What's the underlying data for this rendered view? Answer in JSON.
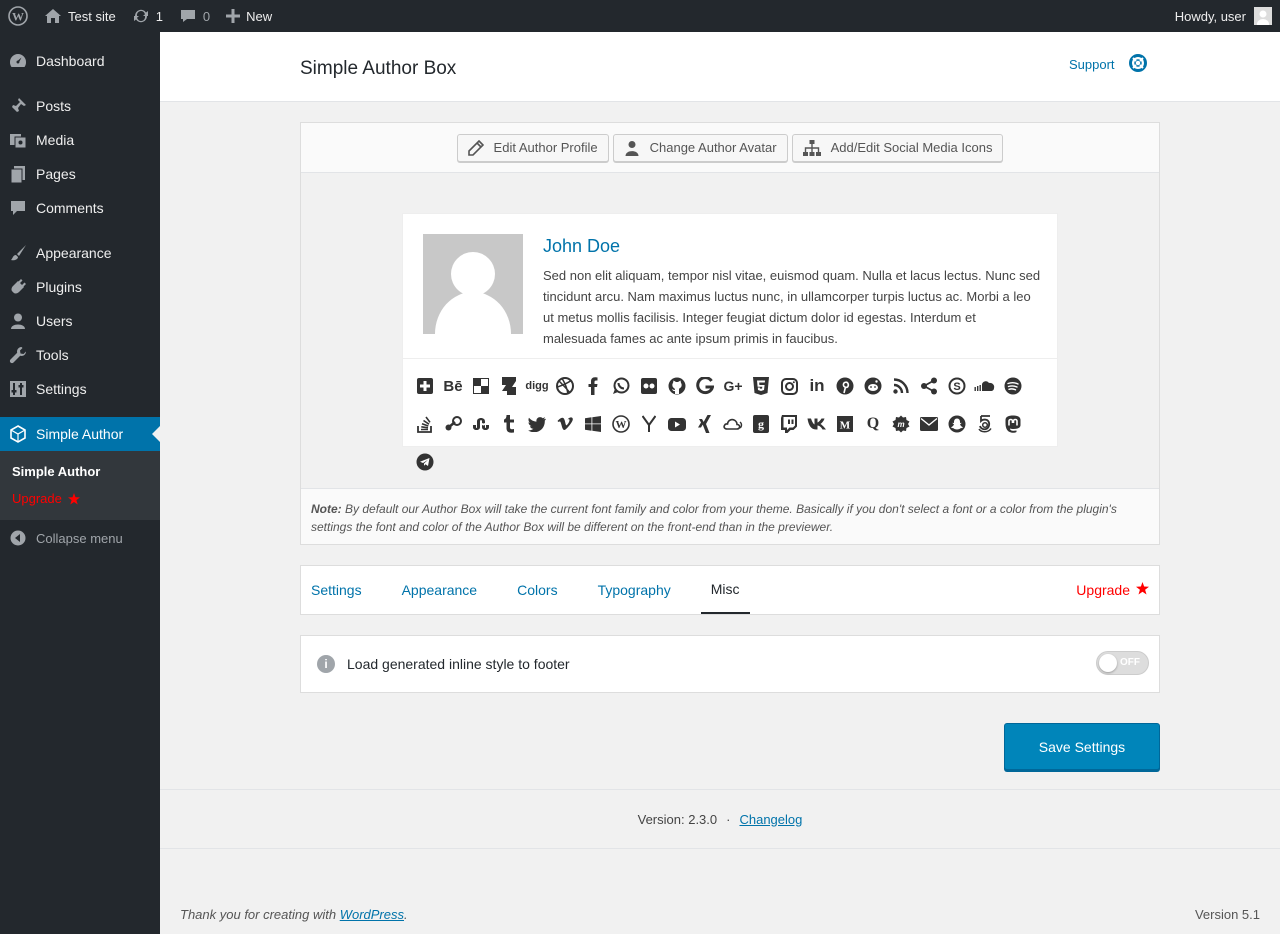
{
  "adminbar": {
    "site_name": "Test site",
    "updates_count": "1",
    "comments_count": "0",
    "new_label": "New",
    "howdy": "Howdy, user"
  },
  "sidebar": {
    "items": [
      {
        "label": "Dashboard",
        "icon": "dashboard-icon"
      },
      {
        "label": "Posts",
        "icon": "pin-icon"
      },
      {
        "label": "Media",
        "icon": "media-icon"
      },
      {
        "label": "Pages",
        "icon": "pages-icon"
      },
      {
        "label": "Comments",
        "icon": "comments-icon"
      },
      {
        "label": "Appearance",
        "icon": "brush-icon"
      },
      {
        "label": "Plugins",
        "icon": "plug-icon"
      },
      {
        "label": "Users",
        "icon": "users-icon"
      },
      {
        "label": "Tools",
        "icon": "wrench-icon"
      },
      {
        "label": "Settings",
        "icon": "sliders-icon"
      },
      {
        "label": "Simple Author",
        "icon": "hexagon-icon"
      }
    ],
    "submenu": {
      "current": "Simple Author",
      "upgrade": "Upgrade"
    },
    "collapse": "Collapse menu"
  },
  "header": {
    "title": "Simple Author Box",
    "support": "Support"
  },
  "toolbar": {
    "edit_profile": "Edit Author Profile",
    "change_avatar": "Change Author Avatar",
    "social_icons": "Add/Edit Social Media Icons"
  },
  "author": {
    "name": "John Doe",
    "description": "Sed non elit aliquam, tempor nisl vitae, euismod quam. Nulla et lacus lectus. Nunc sed tincidunt arcu. Nam maximus luctus nunc, in ullamcorper turpis luctus ac. Morbi a leo ut metus mollis facilisis. Integer feugiat dictum dolor id egestas. Interdum et malesuada fames ac ante ipsum primis in faucibus."
  },
  "social_row1": [
    "add",
    "behance",
    "delicious",
    "deviantart",
    "digg",
    "dribbble",
    "facebook",
    "whatsapp",
    "flickr",
    "github",
    "google",
    "googleplus",
    "html5",
    "instagram",
    "linkedin",
    "pinterest",
    "reddit",
    "rss",
    "share",
    "skype",
    "soundcloud",
    "spotify",
    "stackoverflow"
  ],
  "social_row2": [
    "steam",
    "stumbleupon",
    "tumblr",
    "twitter",
    "vimeo",
    "windows",
    "wordpress",
    "yahoo",
    "youtube",
    "xing",
    "mixcloud",
    "goodreads",
    "twitch",
    "vk",
    "medium",
    "quora",
    "meetup",
    "email",
    "snapchat",
    "500px",
    "mastodon",
    "telegram"
  ],
  "note": {
    "label": "Note:",
    "text": " By default our Author Box will take the current font family and color from your theme. Basically if you don't select a font or a color from the plugin's settings the font and color of the Author Box will be different on the front-end than in the previewer."
  },
  "tabs": {
    "items": [
      "Settings",
      "Appearance",
      "Colors",
      "Typography",
      "Misc"
    ],
    "active": "Misc",
    "upgrade": "Upgrade"
  },
  "option": {
    "label": "Load generated inline style to footer",
    "toggle_state": "OFF"
  },
  "save_button": "Save Settings",
  "version": {
    "text": "Version: 2.3.0",
    "separator": "·",
    "changelog": "Changelog"
  },
  "footer": {
    "thanks_prefix": "Thank you for creating with ",
    "wordpress_link": "WordPress",
    "thanks_suffix": ".",
    "wp_version": "Version 5.1"
  },
  "colors": {
    "admin_dark": "#23282d",
    "accent_blue": "#0073aa",
    "upgrade_red": "#ff0000",
    "save_blue": "#0085ba"
  }
}
